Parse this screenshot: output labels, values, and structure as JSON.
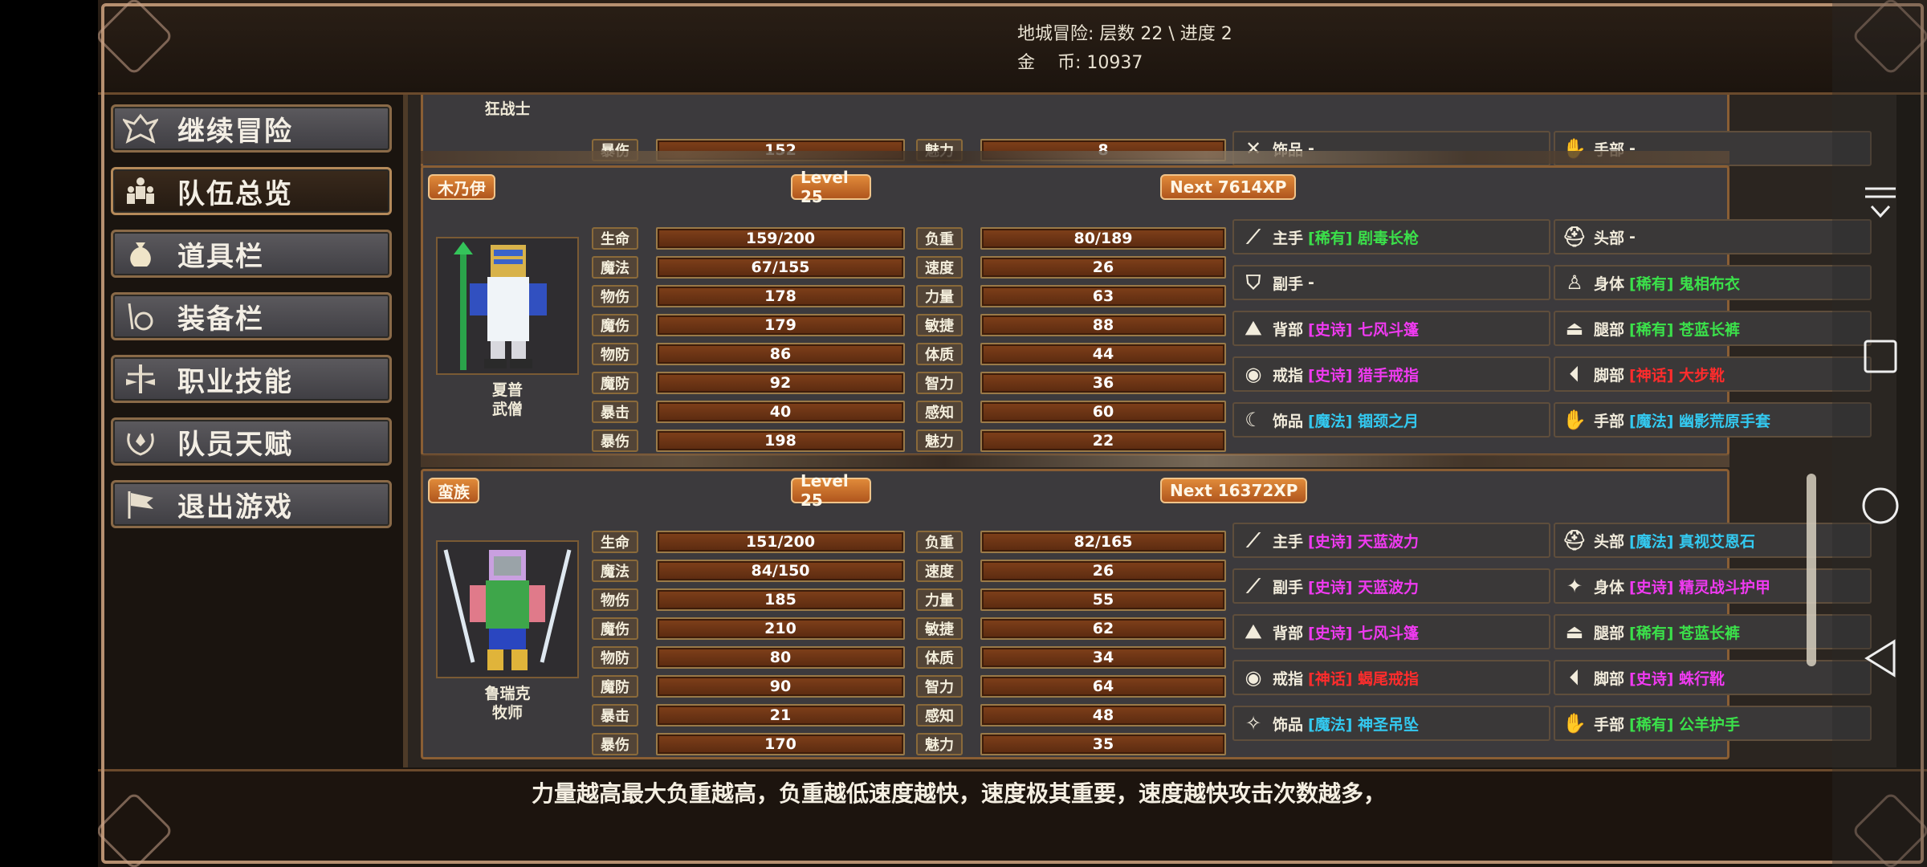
{
  "header": {
    "line1": "地城冒险: 层数 22 \\ 进度 2",
    "line2": "金    币: 10937"
  },
  "menu": [
    {
      "label": "继续冒险",
      "icon": "dragon-icon"
    },
    {
      "label": "队伍总览",
      "icon": "party-icon",
      "active": true
    },
    {
      "label": "道具栏",
      "icon": "bag-icon"
    },
    {
      "label": "装备栏",
      "icon": "equipment-icon"
    },
    {
      "label": "职业技能",
      "icon": "sword-icon"
    },
    {
      "label": "队员天赋",
      "icon": "laurel-icon"
    },
    {
      "label": "退出游戏",
      "icon": "flag-icon"
    }
  ],
  "partial": {
    "name": "狂战士",
    "stats": [
      {
        "l": "暴伤",
        "v": "152",
        "l2": "魅力",
        "v2": "8"
      }
    ],
    "eq": [
      {
        "slot": "饰品",
        "text": "-",
        "rarity": "",
        "icon": "crossed-swords-icon"
      },
      {
        "slot": "手部",
        "text": "-",
        "rarity": "",
        "icon": "glove-icon"
      }
    ]
  },
  "characters": [
    {
      "tag": "木乃伊",
      "level": "Level 25",
      "next": "Next 7614XP",
      "name": "夏普",
      "cls": "武僧",
      "stats": [
        {
          "l": "生命",
          "v": "159/200",
          "l2": "负重",
          "v2": "80/189"
        },
        {
          "l": "魔法",
          "v": "67/155",
          "l2": "速度",
          "v2": "26"
        },
        {
          "l": "物伤",
          "v": "178",
          "l2": "力量",
          "v2": "63"
        },
        {
          "l": "魔伤",
          "v": "179",
          "l2": "敏捷",
          "v2": "88"
        },
        {
          "l": "物防",
          "v": "86",
          "l2": "体质",
          "v2": "44"
        },
        {
          "l": "魔防",
          "v": "92",
          "l2": "智力",
          "v2": "36"
        },
        {
          "l": "暴击",
          "v": "40",
          "l2": "感知",
          "v2": "60"
        },
        {
          "l": "暴伤",
          "v": "198",
          "l2": "魅力",
          "v2": "22"
        }
      ],
      "eq": [
        {
          "slot": "主手",
          "text": "[稀有] 剧毒长枪",
          "rarity": "rare",
          "icon": "spear-icon"
        },
        {
          "slot": "头部",
          "text": "-",
          "rarity": "",
          "icon": "helmet-icon"
        },
        {
          "slot": "副手",
          "text": "-",
          "rarity": "",
          "icon": "shield-icon"
        },
        {
          "slot": "身体",
          "text": "[稀有] 鬼相布衣",
          "rarity": "rare",
          "icon": "robe-icon"
        },
        {
          "slot": "背部",
          "text": "[史诗] 七风斗篷",
          "rarity": "epic",
          "icon": "cloak-icon"
        },
        {
          "slot": "腿部",
          "text": "[稀有] 苍蓝长裤",
          "rarity": "rare",
          "icon": "pants-icon"
        },
        {
          "slot": "戒指",
          "text": "[史诗] 猎手戒指",
          "rarity": "epic",
          "icon": "ring-icon"
        },
        {
          "slot": "脚部",
          "text": "[神话] 大步靴",
          "rarity": "legend",
          "icon": "boots-icon"
        },
        {
          "slot": "饰品",
          "text": "[魔法] 锢颈之月",
          "rarity": "magic",
          "icon": "amulet-icon"
        },
        {
          "slot": "手部",
          "text": "[魔法] 幽影荒原手套",
          "rarity": "magic",
          "icon": "gauntlet-icon"
        }
      ]
    },
    {
      "tag": "蛮族",
      "level": "Level 25",
      "next": "Next 16372XP",
      "name": "鲁瑞克",
      "cls": "牧师",
      "stats": [
        {
          "l": "生命",
          "v": "151/200",
          "l2": "负重",
          "v2": "82/165"
        },
        {
          "l": "魔法",
          "v": "84/150",
          "l2": "速度",
          "v2": "26"
        },
        {
          "l": "物伤",
          "v": "185",
          "l2": "力量",
          "v2": "55"
        },
        {
          "l": "魔伤",
          "v": "210",
          "l2": "敏捷",
          "v2": "62"
        },
        {
          "l": "物防",
          "v": "80",
          "l2": "体质",
          "v2": "34"
        },
        {
          "l": "魔防",
          "v": "90",
          "l2": "智力",
          "v2": "64"
        },
        {
          "l": "暴击",
          "v": "21",
          "l2": "感知",
          "v2": "48"
        },
        {
          "l": "暴伤",
          "v": "170",
          "l2": "魅力",
          "v2": "35"
        }
      ],
      "eq": [
        {
          "slot": "主手",
          "text": "[史诗] 天蓝波力",
          "rarity": "epic",
          "icon": "blade-icon"
        },
        {
          "slot": "头部",
          "text": "[魔法] 真视艾恩石",
          "rarity": "magic",
          "icon": "helmet-icon"
        },
        {
          "slot": "副手",
          "text": "[史诗] 天蓝波力",
          "rarity": "epic",
          "icon": "blade-icon"
        },
        {
          "slot": "身体",
          "text": "[史诗] 精灵战斗护甲",
          "rarity": "epic",
          "icon": "armor-icon"
        },
        {
          "slot": "背部",
          "text": "[史诗] 七风斗篷",
          "rarity": "epic",
          "icon": "cloak-icon"
        },
        {
          "slot": "腿部",
          "text": "[稀有] 苍蓝长裤",
          "rarity": "rare",
          "icon": "pants-icon"
        },
        {
          "slot": "戒指",
          "text": "[神话] 蝎尾戒指",
          "rarity": "legend",
          "icon": "ring-icon"
        },
        {
          "slot": "脚部",
          "text": "[史诗] 蛛行靴",
          "rarity": "epic",
          "icon": "boots-icon"
        },
        {
          "slot": "饰品",
          "text": "[魔法] 神圣吊坠",
          "rarity": "magic",
          "icon": "pendant-icon"
        },
        {
          "slot": "手部",
          "text": "[稀有] 公羊护手",
          "rarity": "rare",
          "icon": "gauntlet-icon"
        }
      ]
    }
  ],
  "footer": {
    "tip": "力量越高最大负重越高，负重越低速度越快，速度极其重要，速度越快攻击次数越多，"
  },
  "colors": {
    "rare": "#3be04a",
    "epic": "#ef3af0",
    "magic": "#33c9f0",
    "legend": "#ff2c2c",
    "tag": "#d9792e"
  }
}
